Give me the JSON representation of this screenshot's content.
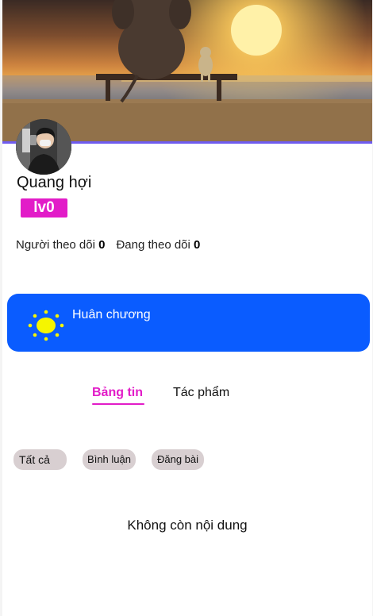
{
  "profile": {
    "name": "Quang hợi",
    "level": "lv0"
  },
  "stats": {
    "followers_label": "Người theo dõi",
    "followers_count": "0",
    "following_label": "Đang theo dõi",
    "following_count": "0"
  },
  "medal": {
    "label": "Huân chương",
    "icon": "sun-icon"
  },
  "tabs": [
    {
      "label": "Bảng tin",
      "active": true
    },
    {
      "label": "Tác phẩm",
      "active": false
    }
  ],
  "filters": [
    {
      "label": "Tất cả"
    },
    {
      "label": "Bình luận"
    },
    {
      "label": "Đăng bài"
    }
  ],
  "empty_message": "Không còn nội dung",
  "colors": {
    "accent": "#e21cc8",
    "medal_bg": "#0a5cff",
    "chip_bg": "#d8cfd1",
    "cover_divider": "#6f5cf0"
  }
}
